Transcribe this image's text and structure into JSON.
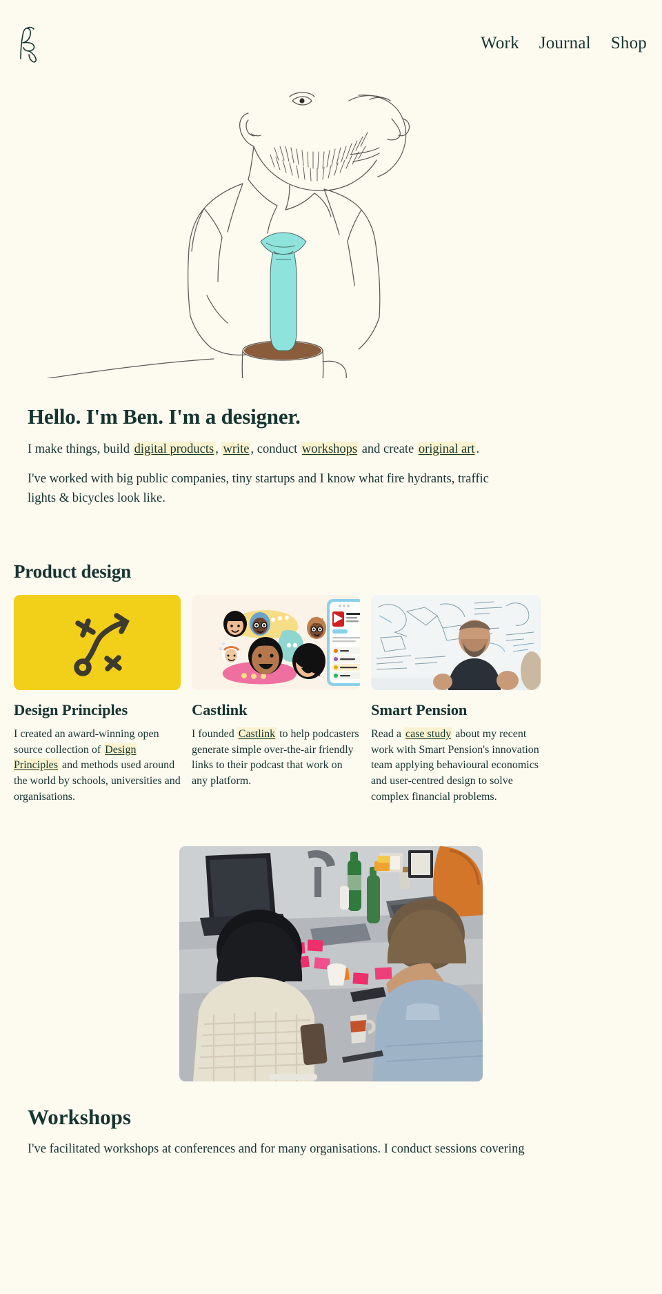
{
  "theme": {
    "background": "#fdfaf0",
    "text": "#16352f",
    "highlight": "#fbf3cf",
    "accent_yellow": "#f2cf18",
    "accent_teal": "#8fe3dd"
  },
  "header": {
    "logo_alt": "Ben monogram logo",
    "nav": [
      {
        "label": "Work"
      },
      {
        "label": "Journal"
      },
      {
        "label": "Shop"
      }
    ]
  },
  "hero": {
    "illustration_alt": "Line drawing of a bearded man in a suit whose teal tie pours into a coffee mug",
    "title": "Hello. I'm Ben. I'm a designer.",
    "intro_parts": {
      "p1_a": "I make things, build ",
      "link_digital_products": "digital products",
      "p1_b": ", ",
      "link_write": "write",
      "p1_c": ", conduct ",
      "link_workshops": "workshops",
      "p1_d": " and create ",
      "link_original_art": "original art",
      "p1_e": "."
    },
    "paragraph2": "I've worked with big public companies, tiny startups and I know what fire hydrants, traffic lights & bicycles look like."
  },
  "product_design": {
    "title": "Product design",
    "cards": [
      {
        "image_name": "strategy-arrow-illustration",
        "title": "Design Principles",
        "body_a": "I created an award-winning open source collection of ",
        "link": "Design Principles",
        "body_b": " and methods used around the world by schools, universities and organisations."
      },
      {
        "image_name": "castlink-podcast-illustration",
        "title": "Castlink",
        "body_a": "I founded ",
        "link": "Castlink",
        "body_b": " to help podcasters generate simple over-the-air friendly links to their podcast that work on any platform."
      },
      {
        "image_name": "smart-pension-whiteboard-photo",
        "title": "Smart Pension",
        "body_a": "Read a ",
        "link": "case study",
        "body_b": " about my recent work with Smart Pension's innovation team applying behavioural economics and user-centred design to solve complex financial problems."
      }
    ]
  },
  "workshops": {
    "photo_alt": "Two people collaborating at a table covered in sticky notes during a workshop",
    "title": "Workshops",
    "body": "I've facilitated workshops at conferences and for many organisations. I conduct sessions covering"
  }
}
